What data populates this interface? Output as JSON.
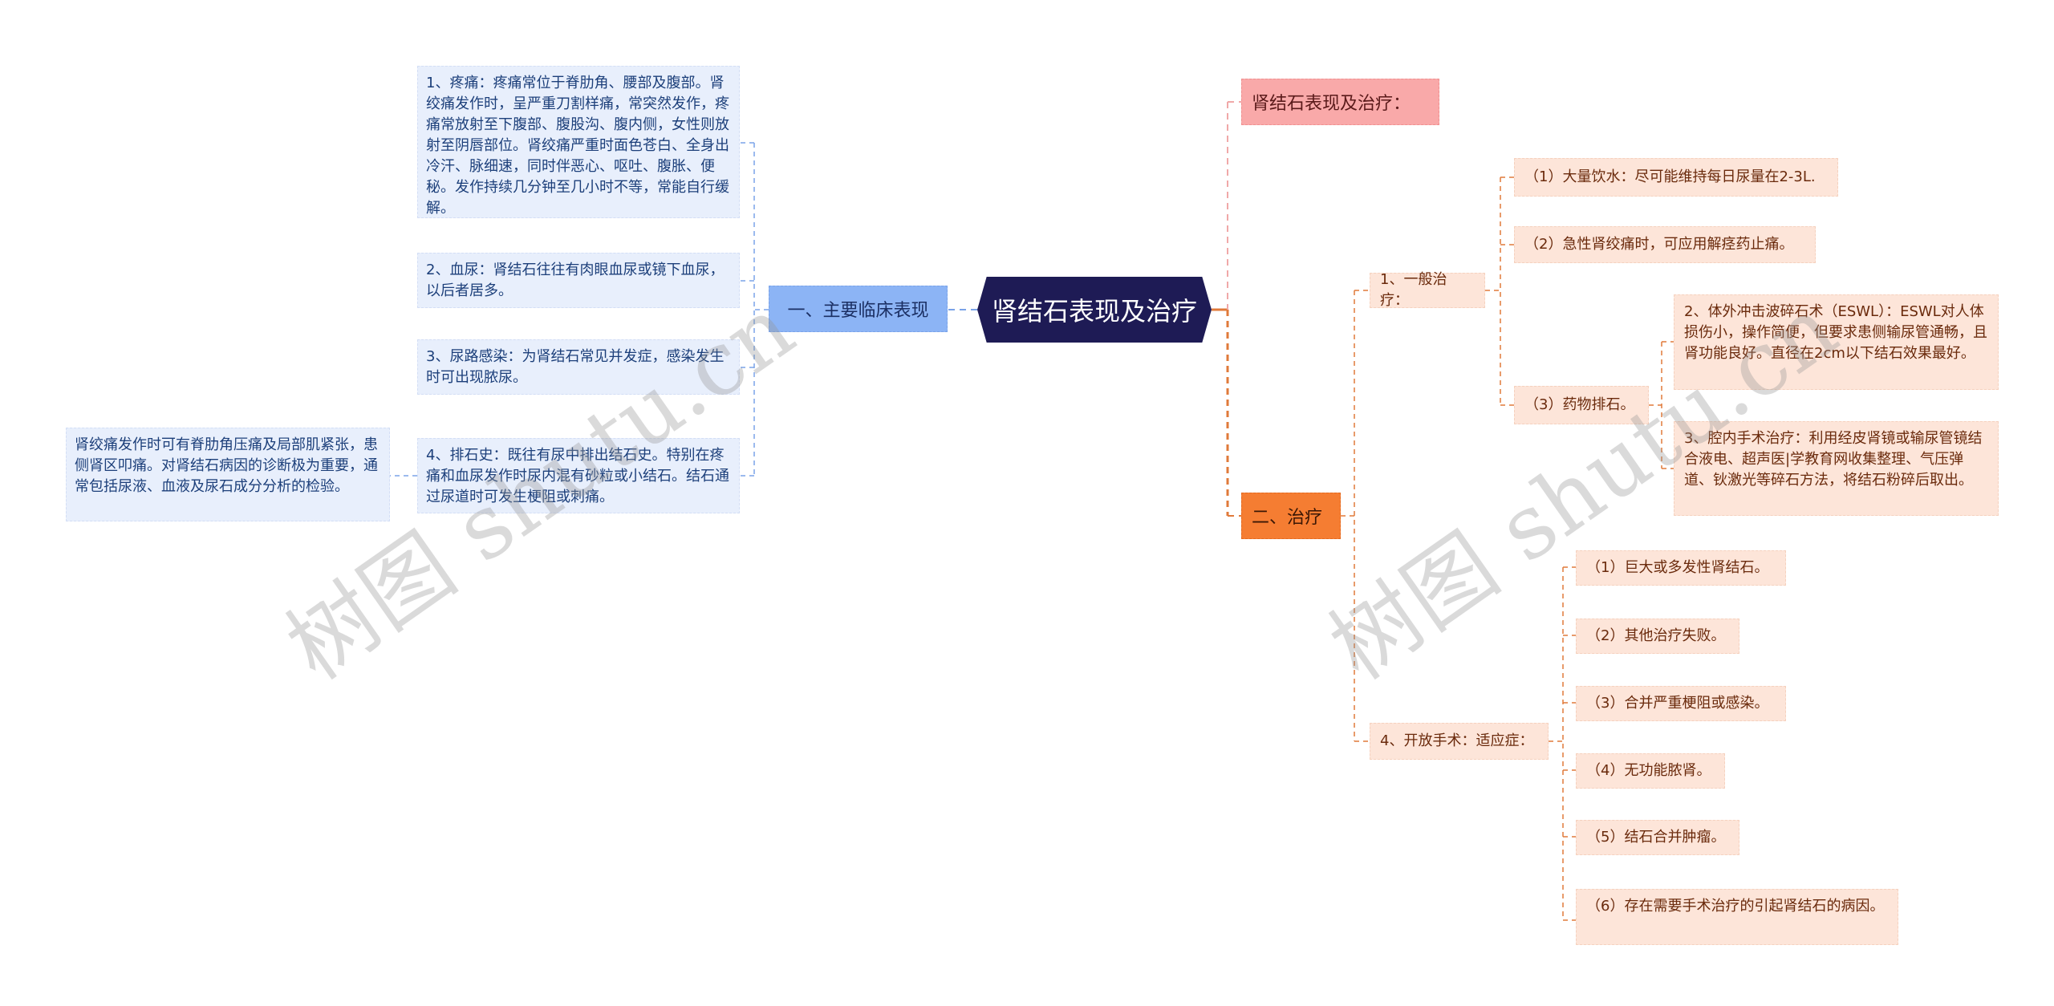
{
  "title": "肾结石表现及治疗",
  "left_branch": {
    "label": "一、主要临床表现",
    "children": [
      {
        "text": "1、疼痛：疼痛常位于脊肋角、腰部及腹部。肾绞痛发作时，呈严重刀割样痛，常突然发作，疼痛常放射至下腹部、腹股沟、腹内侧，女性则放射至阴唇部位。肾绞痛严重时面色苍白、全身出冷汗、脉细速，同时伴恶心、呕吐、腹胀、便秘。发作持续几分钟至几小时不等，常能自行缓解。"
      },
      {
        "text": "2、血尿：肾结石往往有肉眼血尿或镜下血尿，以后者居多。"
      },
      {
        "text": "3、尿路感染：为肾结石常见并发症，感染发生时可出现脓尿。"
      },
      {
        "text": "4、排石史：既往有尿中排出结石史。特别在疼痛和血尿发作时尿内混有砂粒或小结石。结石通过尿道时可发生梗阻或刺痛。",
        "children": [
          {
            "text": "肾绞痛发作时可有脊肋角压痛及局部肌紧张，患侧肾区叩痛。对肾结石病因的诊断极为重要，通常包括尿液、血液及尿石成分分析的检验。"
          }
        ]
      }
    ]
  },
  "right_branches": [
    {
      "label": "肾结石表现及治疗："
    },
    {
      "label": "二、治疗",
      "children": [
        {
          "label": "1、一般治疗：",
          "children": [
            {
              "text": "（1）大量饮水：尽可能维持每日尿量在2-3L."
            },
            {
              "text": "（2）急性肾绞痛时，可应用解痉药止痛。"
            },
            {
              "text": "（3）药物排石。",
              "children": [
                {
                  "text": "2、体外冲击波碎石术（ESWL）：ESWL对人体损伤小，操作简便，但要求患侧输尿管通畅，且肾功能良好。直径在2cm以下结石效果最好。"
                },
                {
                  "text": "3、腔内手术治疗：利用经皮肾镜或输尿管镜结合液电、超声医|学教育网收集整理、气压弹道、钬激光等碎石方法，将结石粉碎后取出。"
                }
              ]
            }
          ]
        },
        {
          "label": "4、开放手术：适应症：",
          "children": [
            {
              "text": "（1）巨大或多发性肾结石。"
            },
            {
              "text": "（2）其他治疗失败。"
            },
            {
              "text": "（3）合并严重梗阻或感染。"
            },
            {
              "text": "（4）无功能脓肾。"
            },
            {
              "text": "（5）结石合并肿瘤。"
            },
            {
              "text": "（6）存在需要手术治疗的引起肾结石的病因。"
            }
          ]
        }
      ]
    }
  ],
  "watermarks": [
    "树图 shutu.cn",
    "树图 shutu.cn"
  ],
  "colors": {
    "center": "#1e1b55",
    "left_branch": "#8cb4f5",
    "pink_branch": "#f9a9a9",
    "orange_branch": "#f57d32",
    "blue_leaf": "#e8effc",
    "peach_leaf": "#fde5d9"
  }
}
